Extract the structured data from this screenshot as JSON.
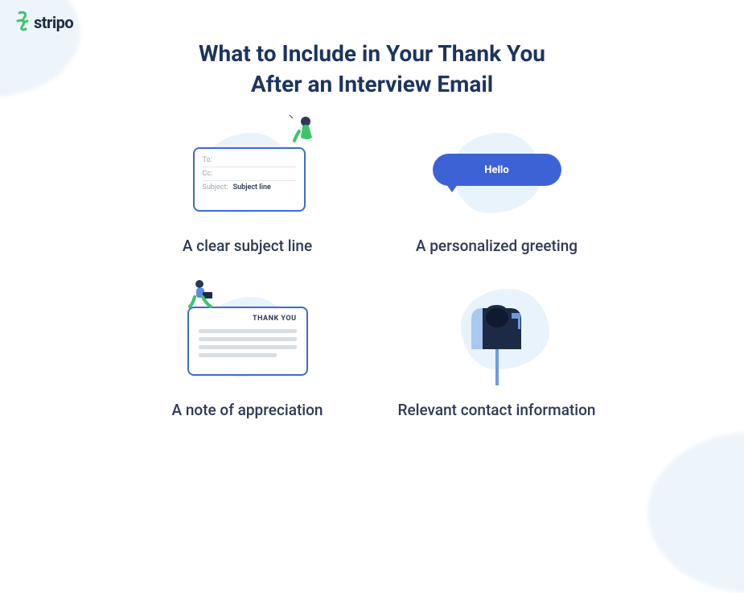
{
  "brand": {
    "name": "stripo"
  },
  "title_line1": "What to Include in Your Thank You",
  "title_line2": "After an Interview Email",
  "items": [
    {
      "caption": "A clear subject line",
      "email_labels": {
        "to": "To:",
        "cc": "Cc:",
        "subject": "Subject:",
        "subject_value": "Subject line"
      }
    },
    {
      "caption": "A personalized greeting",
      "bubble_text": "Hello"
    },
    {
      "caption": "A note of appreciation",
      "card_title": "THANK YOU"
    },
    {
      "caption": "Relevant contact information"
    }
  ],
  "colors": {
    "accent_blue": "#3d62d6",
    "border_blue": "#3a6bd6",
    "navy": "#1c355e",
    "text": "#2d3a53",
    "blob": "#e9f3fb",
    "brand_green": "#3ac569"
  }
}
